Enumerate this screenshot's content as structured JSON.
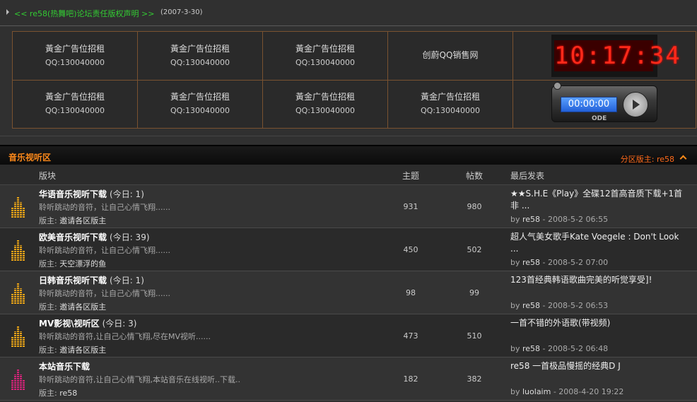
{
  "announcement": {
    "link": "<< re58(热舞吧)论坛责任版权声明 >>",
    "date": "(2007-3-30)"
  },
  "ads": {
    "row1": [
      {
        "title": "黃金广告位招租",
        "sub": "QQ:130040000"
      },
      {
        "title": "黃金广告位招租",
        "sub": "QQ:130040000"
      },
      {
        "title": "黃金广告位招租",
        "sub": "QQ:130040000"
      },
      {
        "title": "创蔚QQ销售网",
        "sub": ""
      }
    ],
    "row2": [
      {
        "title": "黃金广告位招租",
        "sub": "QQ:130040000"
      },
      {
        "title": "黃金广告位招租",
        "sub": "QQ:130040000"
      },
      {
        "title": "黃金广告位招租",
        "sub": "QQ:130040000"
      },
      {
        "title": "黃金广告位招租",
        "sub": "QQ:130040000"
      }
    ],
    "clock_time": "10:17:34",
    "player_time": "00:00:00",
    "player_logo": "ODE"
  },
  "section": {
    "title": "音乐视听区",
    "moderator": "分区版主: re58"
  },
  "columns": {
    "forum": "版块",
    "topics": "主题",
    "posts": "帖数",
    "last_post": "最后发表"
  },
  "forums": [
    {
      "name": "华语音乐视听下载",
      "today": "(今日: 1)",
      "desc": "聆听跳动的音符，让自己心情飞翔......",
      "mods_label": "版主:",
      "mods": "邀请各区版主",
      "topics": "931",
      "posts": "980",
      "last_title": "★★S.H.E《Play》全碟12首高音质下载+1首非  ...",
      "by_label": "by",
      "last_author": "re58",
      "last_time": "- 2008-5-2 06:55",
      "icon_color": "#e8a317"
    },
    {
      "name": "欧美音乐视听下载",
      "today": "(今日: 39)",
      "desc": "聆听跳动的音符，让自己心情飞翔......",
      "mods_label": "版主:",
      "mods": "天空漂浮的鱼",
      "topics": "450",
      "posts": "502",
      "last_title": "超人气美女歌手Kate Voegele : Don't Look ...",
      "by_label": "by",
      "last_author": "re58",
      "last_time": "- 2008-5-2 07:00",
      "icon_color": "#e8a317"
    },
    {
      "name": "日韩音乐视听下载",
      "today": "(今日: 1)",
      "desc": "聆听跳动的音符，让自己心情飞翔......",
      "mods_label": "版主:",
      "mods": "邀请各区版主",
      "topics": "98",
      "posts": "99",
      "last_title": "123首经典韩语歌曲完美的听觉享受]!",
      "by_label": "by",
      "last_author": "re58",
      "last_time": "- 2008-5-2 06:53",
      "icon_color": "#e8a317"
    },
    {
      "name": "MV影视\\视听区",
      "today": "(今日: 3)",
      "desc": "聆听跳动的音符,让自己心情飞翔,尽在MV视听......",
      "mods_label": "版主:",
      "mods": "邀请各区版主",
      "topics": "473",
      "posts": "510",
      "last_title": "一首不错的外语歌(带视频)",
      "by_label": "by",
      "last_author": "re58",
      "last_time": "- 2008-5-2 06:48",
      "icon_color": "#e8a317"
    },
    {
      "name": "本站音乐下载",
      "today": "",
      "desc": "聆听跳动的音符,让自己心情飞翔,本站音乐在线视听..下载..",
      "mods_label": "版主:",
      "mods": "re58",
      "topics": "182",
      "posts": "382",
      "last_title": "re58 一首极品慢摇的经典D J",
      "by_label": "by",
      "last_author": "luolaim",
      "last_time": "- 2008-4-20 19:22",
      "icon_color": "#d6237a"
    }
  ]
}
